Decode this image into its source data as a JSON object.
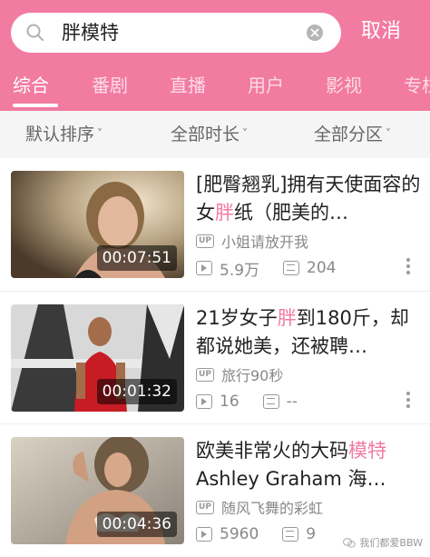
{
  "search": {
    "query": "胖模特",
    "cancel_label": "取消"
  },
  "tabs": [
    {
      "label": "综合",
      "active": true
    },
    {
      "label": "番剧",
      "active": false
    },
    {
      "label": "直播",
      "active": false
    },
    {
      "label": "用户",
      "active": false
    },
    {
      "label": "影视",
      "active": false
    },
    {
      "label": "专栏",
      "active": false
    }
  ],
  "filters": [
    {
      "label": "默认排序"
    },
    {
      "label": "全部时长"
    },
    {
      "label": "全部分区"
    }
  ],
  "videos": [
    {
      "title_before": "[肥臀翘乳]拥有天使面容的女",
      "title_hl": "胖",
      "title_after": "纸（肥美的…",
      "duration": "00:07:51",
      "up_badge": "UP",
      "uploader": "小姐请放开我",
      "views": "5.9万",
      "danmaku": "204"
    },
    {
      "title_before": "21岁女子",
      "title_hl": "胖",
      "title_after": "到180斤，却都说她美，还被聘…",
      "duration": "00:01:32",
      "up_badge": "UP",
      "uploader": "旅行90秒",
      "views": "16",
      "danmaku": "--"
    },
    {
      "title_before": "欧美非常火的大码",
      "title_hl": "模特",
      "title_after": " Ashley Graham 海…",
      "duration": "00:04:36",
      "up_badge": "UP",
      "uploader": "随风飞舞的彩虹",
      "views": "5960",
      "danmaku": "9"
    }
  ],
  "watermark": "我们都爱BBW",
  "colors": {
    "brand_pink": "#f27ba1",
    "filter_bg": "#f5f5f5",
    "meta_gray": "#888888"
  }
}
